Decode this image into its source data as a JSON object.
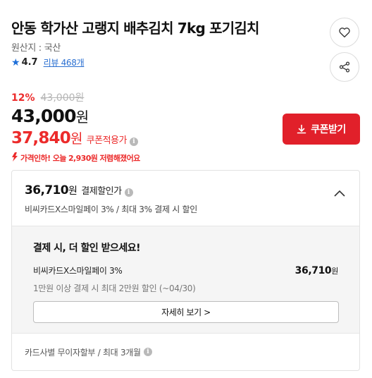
{
  "product": {
    "title": "안동 학가산 고랭지 배추김치 7kg 포기김치",
    "origin": "원산지 : 국산",
    "rating": "4.7",
    "review_link": "리뷰 468개"
  },
  "icons": {
    "star": "star-icon",
    "heart": "heart-icon",
    "share": "share-icon",
    "info": "info-icon",
    "download": "download-icon",
    "chevron_up": "chevron-up-icon",
    "drop_arrow": "down-arrow-icon"
  },
  "price": {
    "discount_rate": "12%",
    "original_price": "43,000원",
    "sale_price_num": "43,000",
    "won": "원",
    "coupon_price_num": "37,840",
    "coupon_label": "쿠폰적용가",
    "info_glyph": "i",
    "drop_note": "가격인하! 오늘 2,930원 저렴해졌어요"
  },
  "coupon_button": {
    "label": "쿠폰받기"
  },
  "payment": {
    "price_num": "36,710",
    "label": "결제할인가",
    "desc": "비씨카드X스마일페이 3% / 최대 3% 결제 시 할인",
    "body_title": "결제 시, 더 할인 받으세요!",
    "card_name": "비씨카드X스마일페이 3%",
    "card_amount_num": "36,710",
    "card_condition": "1만원 이상 결제 시 최대 2만원 할인 (~04/30)",
    "detail_button": "자세히 보기 >",
    "installment": "카드사별 무이자할부 / 최대 3개월"
  },
  "colors": {
    "accent_red": "#ec2b2b",
    "button_red": "#e1202a",
    "link_blue": "#2a6fd1",
    "star_blue": "#1e6fd8"
  }
}
